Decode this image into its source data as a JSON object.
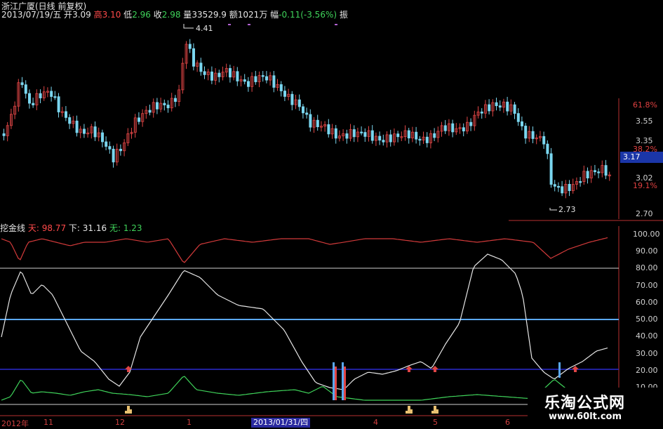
{
  "header": {
    "title": "浙江广厦(日线 前复权)",
    "date": "2013/07/19/五",
    "open_label": "开",
    "open": "3.09",
    "high_label": "高",
    "high": "3.10",
    "low_label": "低",
    "low": "2.96",
    "close_label": "收",
    "close": "2.98",
    "volume_label": "量",
    "volume": "33529.9",
    "amount_label": "额",
    "amount": "1021万",
    "change_label": "幅",
    "change": "-0.11(-3.56%)",
    "amplitude_label": "振"
  },
  "price_chart": {
    "high_marker": "4.41",
    "low_marker": "2.73",
    "right_axis": [
      "61.8%",
      "3.55",
      "3.35",
      "38.2%",
      "3.02",
      "19.1%",
      "2.70"
    ],
    "current_price": "3.17"
  },
  "indicator": {
    "name": "挖金线",
    "series": [
      {
        "name": "天:",
        "value": "98.77",
        "color": "#d23a3a"
      },
      {
        "name": "下:",
        "value": "31.16",
        "color": "#e6e6e6"
      },
      {
        "name": "无:",
        "value": "1.23",
        "color": "#3fd35a"
      }
    ],
    "levels": [
      20,
      50,
      80
    ],
    "right_axis": [
      "100.00",
      "90.00",
      "80.00",
      "70.00",
      "60.00",
      "50.00",
      "40.00",
      "30.00",
      "20.00",
      "10.00"
    ]
  },
  "time_axis": {
    "labels": [
      "2012年",
      "11",
      "12",
      "1",
      "4",
      "5",
      "6"
    ],
    "cursor_date": "2013/01/31/四"
  },
  "watermark": {
    "name": "乐淘公式网",
    "url": "www.60lt.com"
  },
  "colors": {
    "background": "#000000",
    "up_candle": "#e04545",
    "down_candle": "#7ad6ef",
    "level_50": "#5aa8f0",
    "level_20": "#2a2acf",
    "level_80": "#cfcfcf"
  }
}
